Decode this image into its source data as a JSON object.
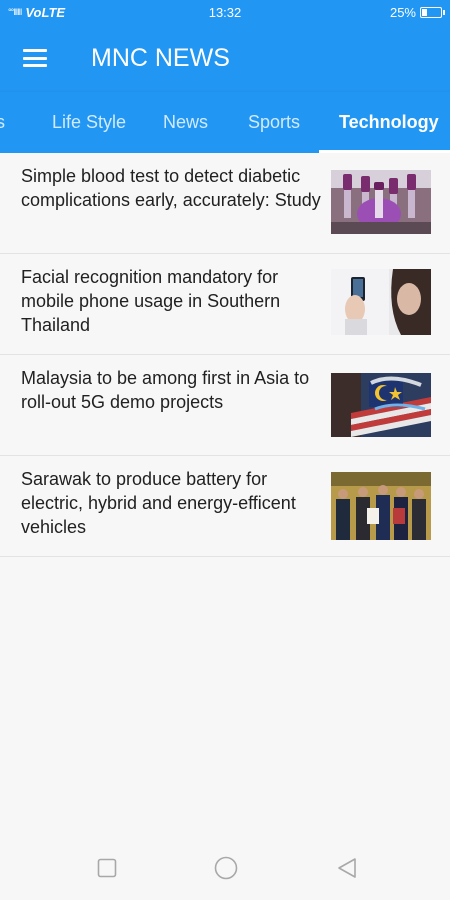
{
  "status_bar": {
    "signal": "°°‖‖‖",
    "network": "VoLTE",
    "time": "13:32",
    "battery": "25%",
    "battery_level": 0.25
  },
  "app_bar": {
    "title": "MNC NEWS",
    "menu_icon": "hamburger-menu-icon"
  },
  "tabs": [
    {
      "label": "s"
    },
    {
      "label": "Life Style"
    },
    {
      "label": "News"
    },
    {
      "label": "Sports"
    },
    {
      "label": "Technology",
      "active": true
    }
  ],
  "articles": [
    {
      "title": "Simple blood test to detect diabetic complications early, accurately: Study",
      "image": "blood-test-tubes-image"
    },
    {
      "title": "Facial recognition mandatory for mobile phone usage in Southern Thailand",
      "image": "phone-face-recognition-image"
    },
    {
      "title": "Malaysia to be among first in Asia to roll-out 5G demo projects",
      "image": "malaysia-flag-image"
    },
    {
      "title": "Sarawak to produce battery for electric, hybrid and energy-efficent vehicles",
      "image": "signing-ceremony-image"
    }
  ],
  "nav_bar": {
    "recent_icon": "square-recent-apps-icon",
    "home_icon": "circle-home-icon",
    "back_icon": "triangle-back-icon"
  },
  "colors": {
    "primary": "#2196f3",
    "background": "#f7f7f7",
    "text": "#212121"
  }
}
